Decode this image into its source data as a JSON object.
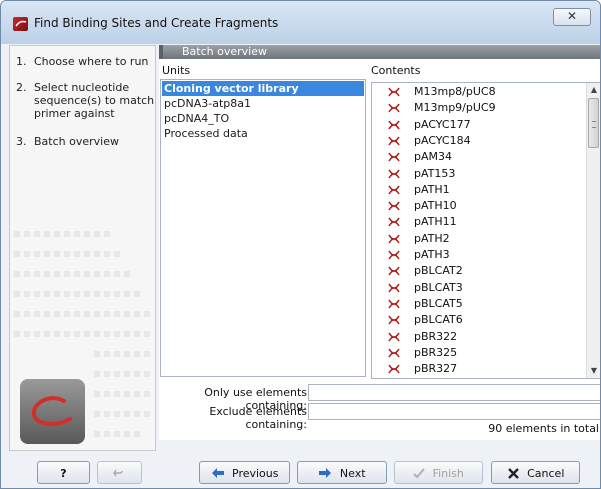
{
  "window": {
    "title": "Find Binding Sites and Create Fragments",
    "close_glyph": "✕"
  },
  "steps": [
    {
      "num": "1.",
      "label": "Choose where to run"
    },
    {
      "num": "2.",
      "label": "Select nucleotide sequence(s) to match primer against"
    },
    {
      "num": "3.",
      "label": "Batch overview"
    }
  ],
  "main": {
    "section_title": "Batch overview",
    "units_label": "Units",
    "contents_label": "Contents",
    "units": [
      {
        "label": "Cloning vector library",
        "selected": true
      },
      {
        "label": "pcDNA3-atp8a1",
        "selected": false
      },
      {
        "label": "pcDNA4_TO",
        "selected": false
      },
      {
        "label": "Processed data",
        "selected": false
      }
    ],
    "contents": [
      "M13mp8/pUC8",
      "M13mp9/pUC9",
      "pACYC177",
      "pACYC184",
      "pAM34",
      "pAT153",
      "pATH1",
      "pATH10",
      "pATH11",
      "pATH2",
      "pATH3",
      "pBLCAT2",
      "pBLCAT3",
      "pBLCAT5",
      "pBLCAT6",
      "pBR322",
      "pBR325",
      "pBR327"
    ],
    "content_icon": "sequence-icon",
    "only_use_label": "Only use elements containing:",
    "only_use_value": "",
    "exclude_label": "Exclude elements containing:",
    "exclude_value": "",
    "count_text": "90 elements in total"
  },
  "buttons": {
    "help": "?",
    "reset_icon": "reset-icon",
    "previous": "Previous",
    "next": "Next",
    "finish": "Finish",
    "cancel": "Cancel"
  },
  "colors": {
    "selection": "#3a87e0",
    "sequence_icon": "#b0201c"
  }
}
